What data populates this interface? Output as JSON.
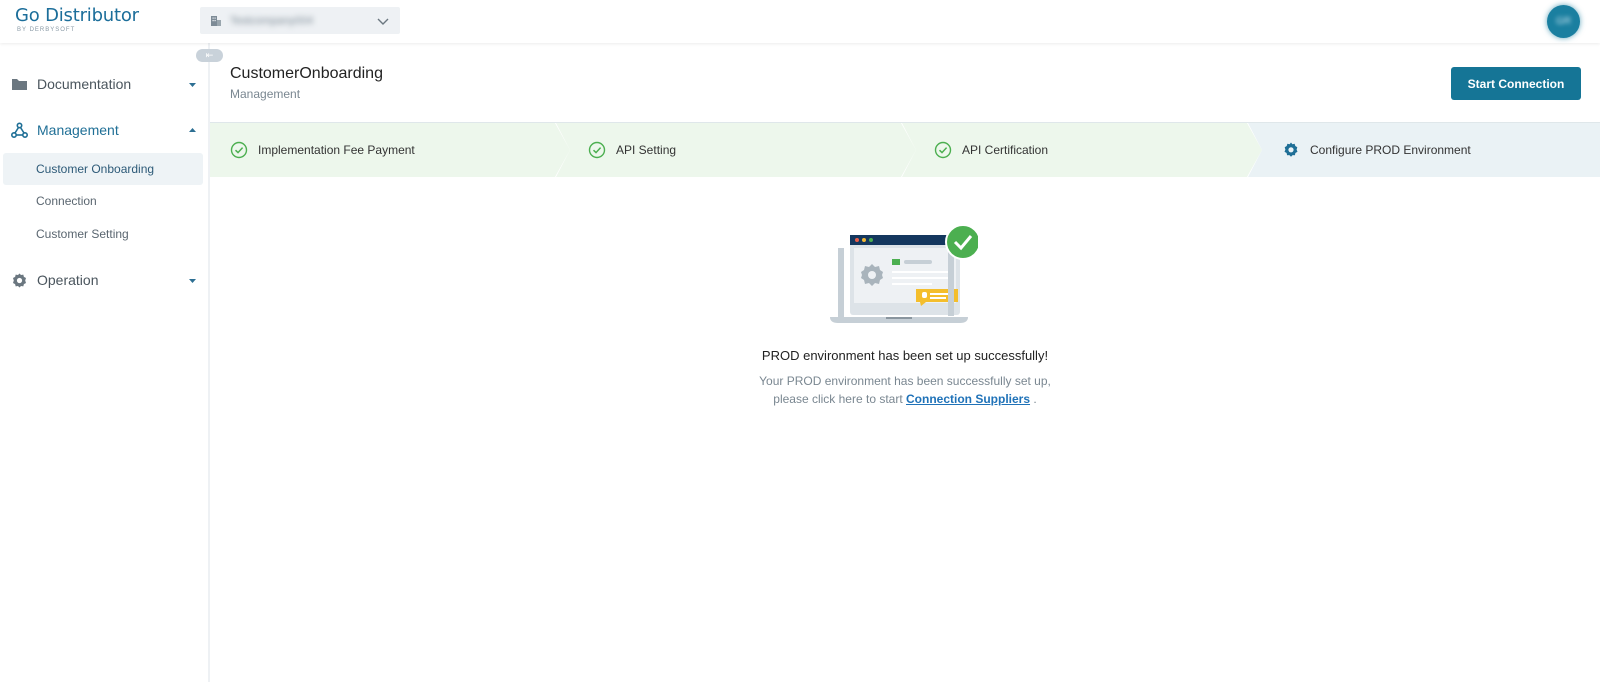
{
  "header": {
    "logo_main": "Go Distributor",
    "logo_sub": "BY DERBYSOFT",
    "company_name": "Testcompany004",
    "avatar_initials": "GR"
  },
  "sidebar": {
    "collapse_symbol": "⇤",
    "groups": [
      {
        "label": "Documentation",
        "icon": "folder-icon",
        "expanded": false
      },
      {
        "label": "Management",
        "icon": "hub-icon",
        "expanded": true,
        "items": [
          {
            "label": "Customer Onboarding",
            "active": true
          },
          {
            "label": "Connection",
            "active": false
          },
          {
            "label": "Customer Setting",
            "active": false
          }
        ]
      },
      {
        "label": "Operation",
        "icon": "gear-icon",
        "expanded": false
      }
    ]
  },
  "page": {
    "title": "CustomerOnboarding",
    "breadcrumb": "Management",
    "start_button": "Start Connection"
  },
  "steps": [
    {
      "label": "Implementation Fee Payment",
      "status": "done"
    },
    {
      "label": "API Setting",
      "status": "done"
    },
    {
      "label": "API Certification",
      "status": "done"
    },
    {
      "label": "Configure PROD Environment",
      "status": "current"
    }
  ],
  "result": {
    "title": "PROD environment has been set up successfully!",
    "desc_line1": "Your PROD environment has been successfully set up,",
    "desc_line2_prefix": "please click here to start",
    "link_text": "Connection Suppliers",
    "desc_line2_suffix": "."
  },
  "colors": {
    "brand": "#1c6e9a",
    "primary_button": "#157596",
    "step_done_bg": "#edf7ec",
    "step_current_bg": "#eaf2f5",
    "success_green": "#4caf50",
    "link": "#1f72b8"
  }
}
